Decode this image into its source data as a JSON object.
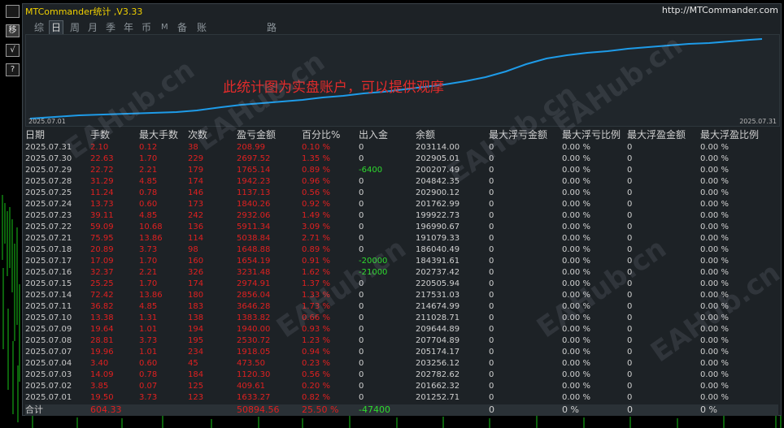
{
  "app": {
    "title": "MTCommander统计 ,V3.33",
    "url": "http://MTCommander.com"
  },
  "side_tools": [
    "移",
    "√",
    "?"
  ],
  "tabs": [
    "综",
    "日",
    "周",
    "月",
    "季",
    "年",
    "币",
    "M",
    "备",
    "账户",
    "路径"
  ],
  "active_tab": "日",
  "chart": {
    "start_label": "2025.07.01",
    "end_label": "2025.07.31",
    "overlay": "此统计图为实盘账户，可以提供观摩",
    "line_color": "#1e9be8"
  },
  "watermark": "EAHub.cn",
  "headers": [
    "日期",
    "手数",
    "最大手数",
    "次数",
    "盈亏金额",
    "百分比%",
    "出入金",
    "余额",
    "最大浮亏金额",
    "最大浮亏比例",
    "最大浮盈金额",
    "最大浮盈比例"
  ],
  "rows": [
    [
      "2025.07.31",
      "2.10",
      "0.12",
      "38",
      "208.99",
      "0.10 %",
      "0",
      "203114.00",
      "0",
      "0.00 %",
      "0",
      "0.00 %"
    ],
    [
      "2025.07.30",
      "22.63",
      "1.70",
      "229",
      "2697.52",
      "1.35 %",
      "0",
      "202905.01",
      "0",
      "0.00 %",
      "0",
      "0.00 %"
    ],
    [
      "2025.07.29",
      "22.72",
      "2.21",
      "179",
      "1765.14",
      "0.89 %",
      "-6400",
      "200207.49",
      "0",
      "0.00 %",
      "0",
      "0.00 %"
    ],
    [
      "2025.07.28",
      "31.29",
      "4.85",
      "174",
      "1942.23",
      "0.96 %",
      "0",
      "204842.35",
      "0",
      "0.00 %",
      "0",
      "0.00 %"
    ],
    [
      "2025.07.25",
      "11.24",
      "0.78",
      "146",
      "1137.13",
      "0.56 %",
      "0",
      "202900.12",
      "0",
      "0.00 %",
      "0",
      "0.00 %"
    ],
    [
      "2025.07.24",
      "13.73",
      "0.60",
      "173",
      "1840.26",
      "0.92 %",
      "0",
      "201762.99",
      "0",
      "0.00 %",
      "0",
      "0.00 %"
    ],
    [
      "2025.07.23",
      "39.11",
      "4.85",
      "242",
      "2932.06",
      "1.49 %",
      "0",
      "199922.73",
      "0",
      "0.00 %",
      "0",
      "0.00 %"
    ],
    [
      "2025.07.22",
      "59.09",
      "10.68",
      "136",
      "5911.34",
      "3.09 %",
      "0",
      "196990.67",
      "0",
      "0.00 %",
      "0",
      "0.00 %"
    ],
    [
      "2025.07.21",
      "75.95",
      "13.86",
      "114",
      "5038.84",
      "2.71 %",
      "0",
      "191079.33",
      "0",
      "0.00 %",
      "0",
      "0.00 %"
    ],
    [
      "2025.07.18",
      "20.89",
      "3.73",
      "98",
      "1648.88",
      "0.89 %",
      "0",
      "186040.49",
      "0",
      "0.00 %",
      "0",
      "0.00 %"
    ],
    [
      "2025.07.17",
      "17.09",
      "1.70",
      "160",
      "1654.19",
      "0.91 %",
      "-20000",
      "184391.61",
      "0",
      "0.00 %",
      "0",
      "0.00 %"
    ],
    [
      "2025.07.16",
      "32.37",
      "2.21",
      "326",
      "3231.48",
      "1.62 %",
      "-21000",
      "202737.42",
      "0",
      "0.00 %",
      "0",
      "0.00 %"
    ],
    [
      "2025.07.15",
      "25.25",
      "1.70",
      "174",
      "2974.91",
      "1.37 %",
      "0",
      "220505.94",
      "0",
      "0.00 %",
      "0",
      "0.00 %"
    ],
    [
      "2025.07.14",
      "72.42",
      "13.86",
      "180",
      "2856.04",
      "1.33 %",
      "0",
      "217531.03",
      "0",
      "0.00 %",
      "0",
      "0.00 %"
    ],
    [
      "2025.07.11",
      "36.82",
      "4.85",
      "183",
      "3646.28",
      "1.73 %",
      "0",
      "214674.99",
      "0",
      "0.00 %",
      "0",
      "0.00 %"
    ],
    [
      "2025.07.10",
      "13.38",
      "1.31",
      "138",
      "1383.82",
      "0.66 %",
      "0",
      "211028.71",
      "0",
      "0.00 %",
      "0",
      "0.00 %"
    ],
    [
      "2025.07.09",
      "19.64",
      "1.01",
      "194",
      "1940.00",
      "0.93 %",
      "0",
      "209644.89",
      "0",
      "0.00 %",
      "0",
      "0.00 %"
    ],
    [
      "2025.07.08",
      "28.81",
      "3.73",
      "195",
      "2530.72",
      "1.23 %",
      "0",
      "207704.89",
      "0",
      "0.00 %",
      "0",
      "0.00 %"
    ],
    [
      "2025.07.07",
      "19.96",
      "1.01",
      "234",
      "1918.05",
      "0.94 %",
      "0",
      "205174.17",
      "0",
      "0.00 %",
      "0",
      "0.00 %"
    ],
    [
      "2025.07.04",
      "3.40",
      "0.60",
      "45",
      "473.50",
      "0.23 %",
      "0",
      "203256.12",
      "0",
      "0.00 %",
      "0",
      "0.00 %"
    ],
    [
      "2025.07.03",
      "14.09",
      "0.78",
      "184",
      "1120.30",
      "0.56 %",
      "0",
      "202782.62",
      "0",
      "0.00 %",
      "0",
      "0.00 %"
    ],
    [
      "2025.07.02",
      "3.85",
      "0.07",
      "125",
      "409.61",
      "0.20 %",
      "0",
      "201662.32",
      "0",
      "0.00 %",
      "0",
      "0.00 %"
    ],
    [
      "2025.07.01",
      "19.50",
      "3.73",
      "123",
      "1633.27",
      "0.82 %",
      "0",
      "201252.71",
      "0",
      "0.00 %",
      "0",
      "0.00 %"
    ]
  ],
  "totals": [
    "合计",
    "604.33",
    "",
    "",
    "50894.56",
    "25.50 %",
    "-47400",
    "",
    "0",
    "0 %",
    "0",
    "0 %"
  ]
}
